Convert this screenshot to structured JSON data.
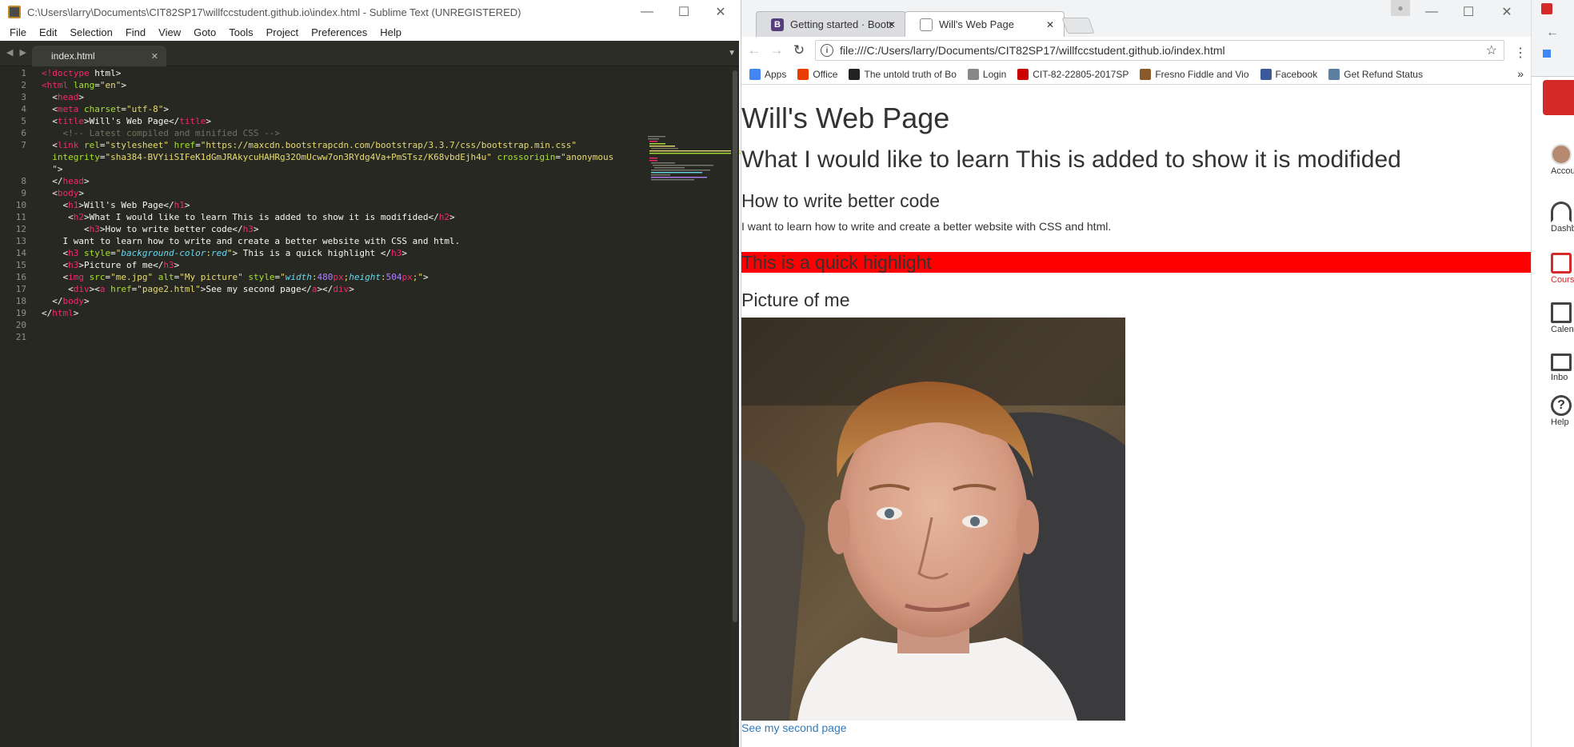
{
  "sublime": {
    "title": "C:\\Users\\larry\\Documents\\CIT82SP17\\willfccstudent.github.io\\index.html - Sublime Text (UNREGISTERED)",
    "menu": [
      "File",
      "Edit",
      "Selection",
      "Find",
      "View",
      "Goto",
      "Tools",
      "Project",
      "Preferences",
      "Help"
    ],
    "tab_label": "index.html",
    "line_numbers": [
      "1",
      "2",
      "3",
      "4",
      "5",
      "6",
      "7",
      "",
      "8",
      "9",
      "10",
      "11",
      "12",
      "13",
      "14",
      "15",
      "16",
      "17",
      "18",
      "19",
      "20",
      "21"
    ]
  },
  "chrome": {
    "tabs": [
      {
        "label": "Getting started · Bootstr",
        "favicon": "B"
      },
      {
        "label": "Will's Web Page"
      }
    ],
    "url": "file:///C:/Users/larry/Documents/CIT82SP17/willfccstudent.github.io/index.html",
    "bookmarks": [
      {
        "label": "Apps",
        "color": "#4285f4"
      },
      {
        "label": "Office",
        "color": "#eb3c00"
      },
      {
        "label": "The untold truth of Bo",
        "color": "#222222"
      },
      {
        "label": "Login",
        "color": "#888888"
      },
      {
        "label": "CIT-82-22805-2017SP",
        "color": "#cc0000"
      },
      {
        "label": "Fresno Fiddle and Vio",
        "color": "#8b5a2b"
      },
      {
        "label": "Facebook",
        "color": "#3b5998"
      },
      {
        "label": "Get Refund Status",
        "color": "#5a7fa0"
      }
    ],
    "page": {
      "h1": "Will's Web Page",
      "h2": "What I would like to learn This is added to show it is modifided",
      "h3": "How to write better code",
      "paragraph": "I want to learn how to write and create a better website with CSS and html.",
      "highlight": "This is a quick highlight",
      "picture_heading": "Picture of me",
      "link": "See my second page"
    }
  },
  "canvas_sidebar": {
    "items": [
      "Accou",
      "Dashbo",
      "Cours",
      "Calend",
      "Inbo",
      "Help"
    ],
    "accent": "#d42a2a"
  }
}
